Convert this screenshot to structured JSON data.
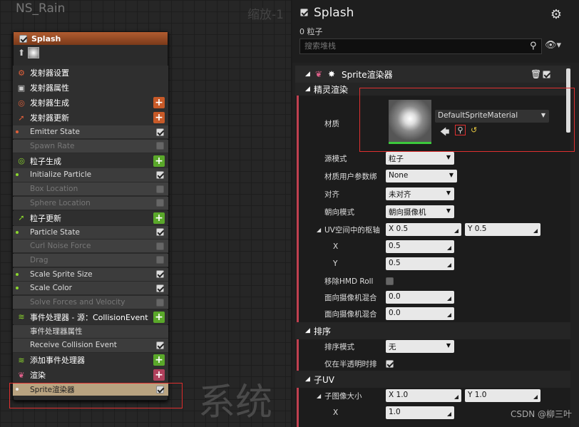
{
  "graph": {
    "title": "NS_Rain",
    "zoom": "缩放-1",
    "watermark": "系统"
  },
  "node": {
    "title": "Splash",
    "rows": [
      {
        "label": "发射器设置",
        "kind": "sec",
        "icon": "settings-icon",
        "color": "#e0603a"
      },
      {
        "label": "发射器属性",
        "kind": "sec",
        "icon": "cpu-icon",
        "color": "#ccc"
      },
      {
        "label": "发射器生成",
        "kind": "sec",
        "icon": "spawn-icon",
        "color": "#e0603a",
        "add": "#c85a28"
      },
      {
        "label": "发射器更新",
        "kind": "sec",
        "icon": "update-icon",
        "color": "#e0603a",
        "add": "#c85a28"
      },
      {
        "label": "Emitter State",
        "kind": "item",
        "on": true,
        "dot": "#e0603a"
      },
      {
        "label": "Spawn Rate",
        "kind": "item",
        "dim": true,
        "on": false
      },
      {
        "label": "粒子生成",
        "kind": "sec",
        "icon": "spawn-icon",
        "color": "#8bd62e",
        "add": "#5aa82a"
      },
      {
        "label": "Initialize Particle",
        "kind": "item",
        "on": true,
        "dot": "#8bd62e"
      },
      {
        "label": "Box Location",
        "kind": "item",
        "dim": true,
        "on": false
      },
      {
        "label": "Sphere Location",
        "kind": "item",
        "dim": true,
        "on": false
      },
      {
        "label": "粒子更新",
        "kind": "sec",
        "icon": "update-icon",
        "color": "#8bd62e",
        "add": "#5aa82a"
      },
      {
        "label": "Particle State",
        "kind": "item",
        "on": true,
        "dot": "#8bd62e"
      },
      {
        "label": "Curl Noise Force",
        "kind": "item",
        "dim": true,
        "on": false
      },
      {
        "label": "Drag",
        "kind": "item",
        "dim": true,
        "on": false
      },
      {
        "label": "Scale Sprite Size",
        "kind": "item",
        "on": true,
        "dot": "#8bd62e"
      },
      {
        "label": "Scale Color",
        "kind": "item",
        "on": true,
        "dot": "#8bd62e"
      },
      {
        "label": "Solve Forces and Velocity",
        "kind": "item",
        "dim": true,
        "on": false
      },
      {
        "label": "事件处理器 - 源：CollisionEvent",
        "kind": "sec",
        "icon": "event-icon",
        "color": "#8bd62e",
        "add": "#5aa82a"
      },
      {
        "label": "事件处理器属性",
        "kind": "item",
        "noCb": true
      },
      {
        "label": "Receive Collision Event",
        "kind": "item",
        "on": true
      },
      {
        "label": "添加事件处理器",
        "kind": "sec",
        "icon": "event-icon",
        "color": "#8bd62e",
        "add": "#5aa82a"
      },
      {
        "label": "渲染",
        "kind": "sec",
        "icon": "render-icon",
        "color": "#e0608a",
        "add": "#b0405c"
      },
      {
        "label": "Sprite渲染器",
        "kind": "item",
        "on": true,
        "hl": true,
        "dot": "#eee"
      }
    ]
  },
  "details": {
    "title": "Splash",
    "count": "0 粒子",
    "search_placeholder": "搜索堆栈",
    "module": "Sprite渲染器",
    "section1": "精灵渲染",
    "material_label": "材质",
    "material_value": "DefaultSpriteMaterial",
    "props": [
      {
        "label": "源模式",
        "value": "粒子",
        "type": "d",
        "w": 96
      },
      {
        "label": "材质用户参数绑",
        "value": "None",
        "type": "d",
        "w": 100
      },
      {
        "label": "对齐",
        "value": "未对齐",
        "type": "d",
        "w": 96
      },
      {
        "label": "朝向模式",
        "value": "朝向摄像机",
        "type": "d",
        "w": 96
      }
    ],
    "uv_label": "UV空间中的枢轴",
    "uv_x": "X  0.5",
    "uv_y": "Y  0.5",
    "x_label": "X",
    "x_val": "0.5",
    "y_label": "Y",
    "y_val": "0.5",
    "hmd_label": "移除HMD Roll",
    "blend1_label": "面向摄像机混合",
    "blend1": "0.0",
    "blend2_label": "面向摄像机混合",
    "blend2": "0.0",
    "sort_section": "排序",
    "sort_label": "排序模式",
    "sort_value": "无",
    "translucent_label": "仅在半透明时排",
    "subuv_section": "子UV",
    "subsize_label": "子图像大小",
    "sub_x": "X  1.0",
    "sub_y": "Y  1.0",
    "subx_label": "X",
    "subx_val": "1.0"
  },
  "credit": "CSDN @柳三叶"
}
